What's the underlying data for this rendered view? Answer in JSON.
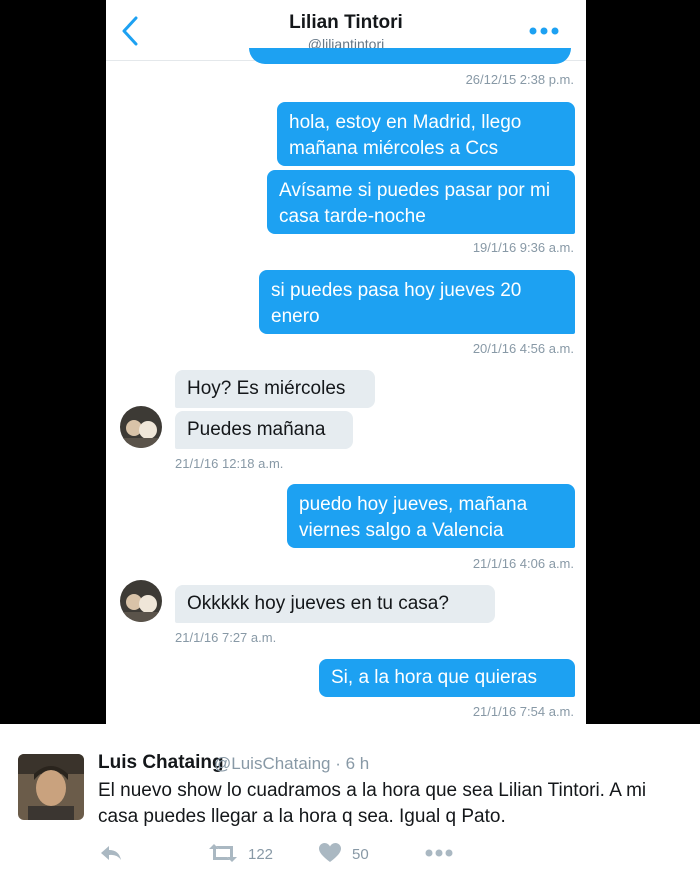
{
  "conversation": {
    "title": "Lilian Tintori",
    "handle": "@liliantintori",
    "messages": [
      {
        "text": "hola, estoy en Madrid, llego mañana miércoles a Ccs"
      },
      {
        "text": "Avísame si puedes pasar por mi casa tarde-noche"
      },
      {
        "text": "si puedes pasa hoy jueves 20 enero"
      },
      {
        "text": "Hoy? Es miércoles"
      },
      {
        "text": "Puedes mañana"
      },
      {
        "text": "puedo hoy jueves, mañana viernes salgo a Valencia"
      },
      {
        "text": "Okkkkk hoy jueves en tu casa?"
      },
      {
        "text": "Si, a la hora que quieras"
      }
    ],
    "timestamps": [
      "26/12/15 2:38 p.m.",
      "19/1/16 9:36 a.m.",
      "20/1/16 4:56 a.m.",
      "21/1/16 12:18 a.m.",
      "21/1/16 4:06 a.m.",
      "21/1/16 7:27 a.m.",
      "21/1/16 7:54 a.m."
    ]
  },
  "tweet": {
    "author_name": "Luis Chataing",
    "meta": "@LuisChataing · 6 h",
    "text": "El nuevo show lo cuadramos a la hora que sea Lilian Tintori. A mi casa puedes llegar a la hora q sea. Igual q Pato.",
    "retweets": "122",
    "likes": "50"
  },
  "colors": {
    "outgoing_bubble": "#1da1f2",
    "incoming_bubble": "#e6ecf0",
    "timestamp": "#8899a6"
  },
  "icons": [
    "back-chevron-icon",
    "more-dots-icon",
    "reply-icon",
    "retweet-icon",
    "heart-icon",
    "more-icon"
  ]
}
